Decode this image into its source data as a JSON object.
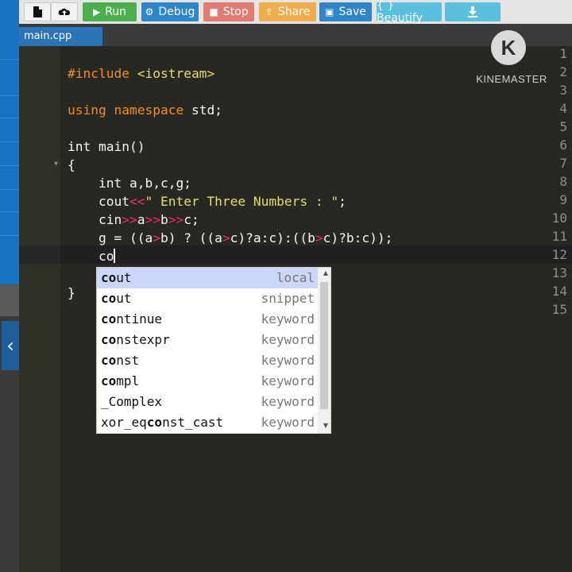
{
  "toolbar": {
    "new_file_icon": "file-icon",
    "upload_icon": "cloud-upload-icon",
    "run_label": "Run",
    "debug_label": "Debug",
    "stop_label": "Stop",
    "share_label": "Share",
    "save_label": "Save",
    "beautify_label": "{ } Beautify",
    "download_icon": "download-icon"
  },
  "tab": {
    "filename": "main.cpp"
  },
  "editor": {
    "line_numbers": [
      "1",
      "2",
      "3",
      "4",
      "5",
      "6",
      "7",
      "8",
      "9",
      "10",
      "11",
      "12",
      "13",
      "14",
      "15"
    ],
    "current_line": 12,
    "typed_text": "co"
  },
  "autocomplete": {
    "items": [
      {
        "name": "cout",
        "meta": "local"
      },
      {
        "name": "cout",
        "meta": "snippet"
      },
      {
        "name": "continue",
        "meta": "keyword"
      },
      {
        "name": "constexpr",
        "meta": "keyword"
      },
      {
        "name": "const",
        "meta": "keyword"
      },
      {
        "name": "compl",
        "meta": "keyword"
      },
      {
        "name": "_Complex",
        "meta": "keyword"
      },
      {
        "name": "xor_eqconst_cast",
        "meta": "keyword"
      }
    ],
    "selected_index": 0
  },
  "watermark": {
    "text": "KINEMASTER",
    "logo_letter": "K"
  },
  "colors": {
    "run": "#4cae4c",
    "debug": "#2f85c8",
    "stop": "#e07a72",
    "share": "#f0ad4e",
    "save": "#2f85c8",
    "beautify": "#5bc0de",
    "editor_bg": "#272822",
    "keyword": "#f92672",
    "string": "#e6db74"
  }
}
